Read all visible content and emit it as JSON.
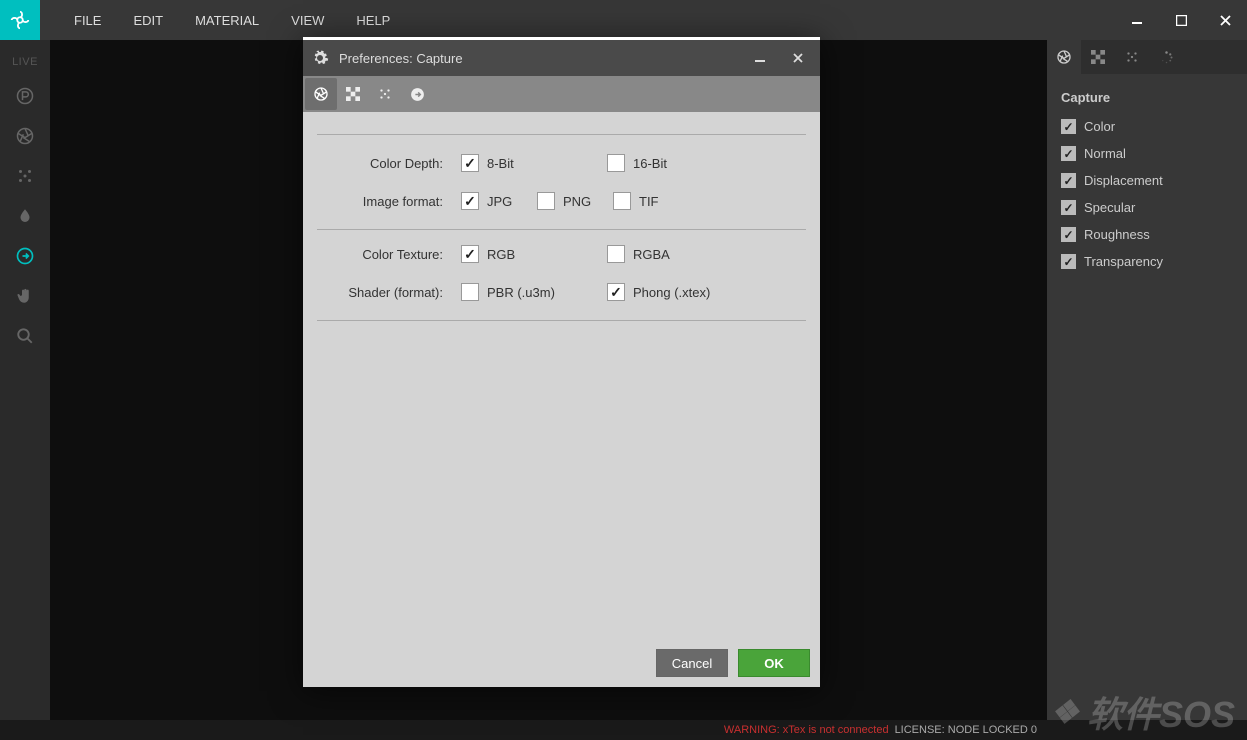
{
  "menu": {
    "items": [
      "FILE",
      "EDIT",
      "MATERIAL",
      "VIEW",
      "HELP"
    ]
  },
  "left_toolbar": {
    "live_label": "LIVE"
  },
  "right_panel": {
    "title": "Capture",
    "checks": [
      {
        "label": "Color",
        "checked": true
      },
      {
        "label": "Normal",
        "checked": true
      },
      {
        "label": "Displacement",
        "checked": true
      },
      {
        "label": "Specular",
        "checked": true
      },
      {
        "label": "Roughness",
        "checked": true
      },
      {
        "label": "Transparency",
        "checked": true
      }
    ]
  },
  "dialog": {
    "title": "Preferences: Capture",
    "rows": {
      "color_depth": {
        "label": "Color Depth:",
        "opts": [
          {
            "label": "8-Bit",
            "checked": true
          },
          {
            "label": "16-Bit",
            "checked": false
          }
        ]
      },
      "image_format": {
        "label": "Image format:",
        "opts": [
          {
            "label": "JPG",
            "checked": true
          },
          {
            "label": "PNG",
            "checked": false
          },
          {
            "label": "TIF",
            "checked": false
          }
        ]
      },
      "color_texture": {
        "label": "Color Texture:",
        "opts": [
          {
            "label": "RGB",
            "checked": true
          },
          {
            "label": "RGBA",
            "checked": false
          }
        ]
      },
      "shader_format": {
        "label": "Shader (format):",
        "opts": [
          {
            "label": "PBR (.u3m)",
            "checked": false
          },
          {
            "label": "Phong (.xtex)",
            "checked": true
          }
        ]
      }
    },
    "buttons": {
      "cancel": "Cancel",
      "ok": "OK"
    }
  },
  "status": {
    "warning": "WARNING: xTex is not connected",
    "license": "LICENSE: NODE LOCKED 0"
  },
  "watermark": "软件SOS"
}
